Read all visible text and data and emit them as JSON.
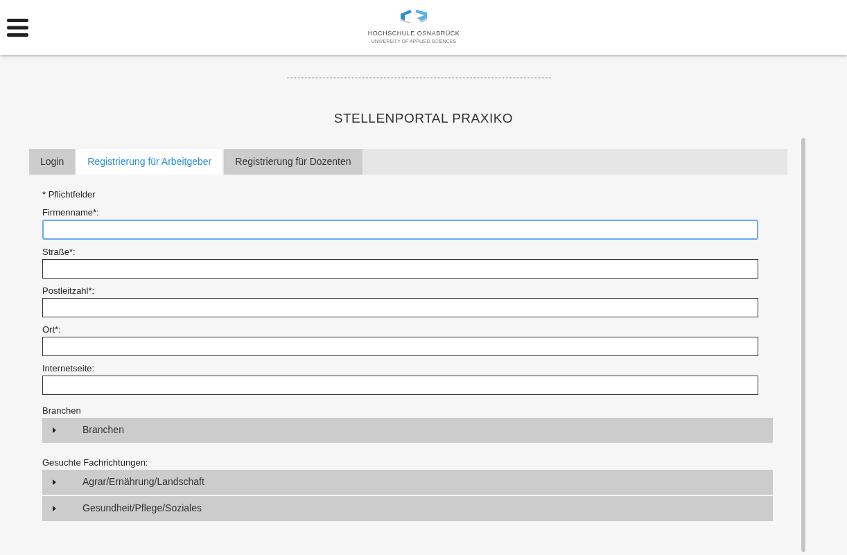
{
  "header": {
    "logo": {
      "name": "HOCHSCHULE OSNABRÜCK",
      "tagline": "UNIVERSITY OF APPLIED SCIENCES"
    }
  },
  "page_title": "STELLENPORTAL PRAXIKO",
  "tabs": [
    {
      "label": "Login",
      "selected": false
    },
    {
      "label": "Registrierung für Arbeitgeber",
      "selected": true
    },
    {
      "label": "Registrierung für Dozenten",
      "selected": false
    }
  ],
  "required_note": "* Pflichtfelder",
  "fields": [
    {
      "label": "Firmenname*:",
      "focused": true
    },
    {
      "label": "Straße*:",
      "focused": false
    },
    {
      "label": "Postleitzahl*:",
      "focused": false
    },
    {
      "label": "Ort*:",
      "focused": false
    },
    {
      "label": "Internetseite:",
      "focused": false
    }
  ],
  "groups": [
    {
      "heading": "Branchen",
      "items": [
        {
          "label": "Branchen",
          "expanded": false
        }
      ]
    },
    {
      "heading": "Gesuchte Fachrichtungen:",
      "items": [
        {
          "label": "Agrar/Ernährung/Landschaft",
          "expanded": false
        },
        {
          "label": "Gesundheit/Pflege/Soziales",
          "expanded": false
        }
      ]
    }
  ]
}
